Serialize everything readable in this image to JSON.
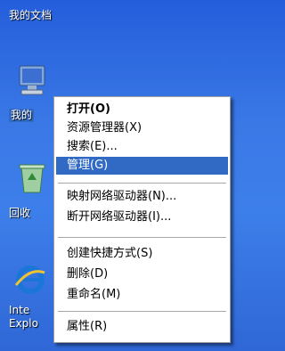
{
  "desktop": {
    "icons": [
      {
        "label": "我的文档"
      },
      {
        "label": "我的"
      },
      {
        "label": "回收"
      },
      {
        "label_line1": "Inte",
        "label_line2": "Explo"
      }
    ]
  },
  "menu": {
    "items": [
      {
        "label": "打开(O)"
      },
      {
        "label": "资源管理器(X)"
      },
      {
        "label": "搜索(E)..."
      },
      {
        "label": "管理(G)"
      },
      {
        "label": "映射网络驱动器(N)..."
      },
      {
        "label": "断开网络驱动器(I)..."
      },
      {
        "label": "创建快捷方式(S)"
      },
      {
        "label": "删除(D)"
      },
      {
        "label": "重命名(M)"
      },
      {
        "label": "属性(R)"
      }
    ]
  },
  "colors": {
    "desktop_blue": "#3a78e6",
    "menu_highlight": "#316ac5"
  }
}
